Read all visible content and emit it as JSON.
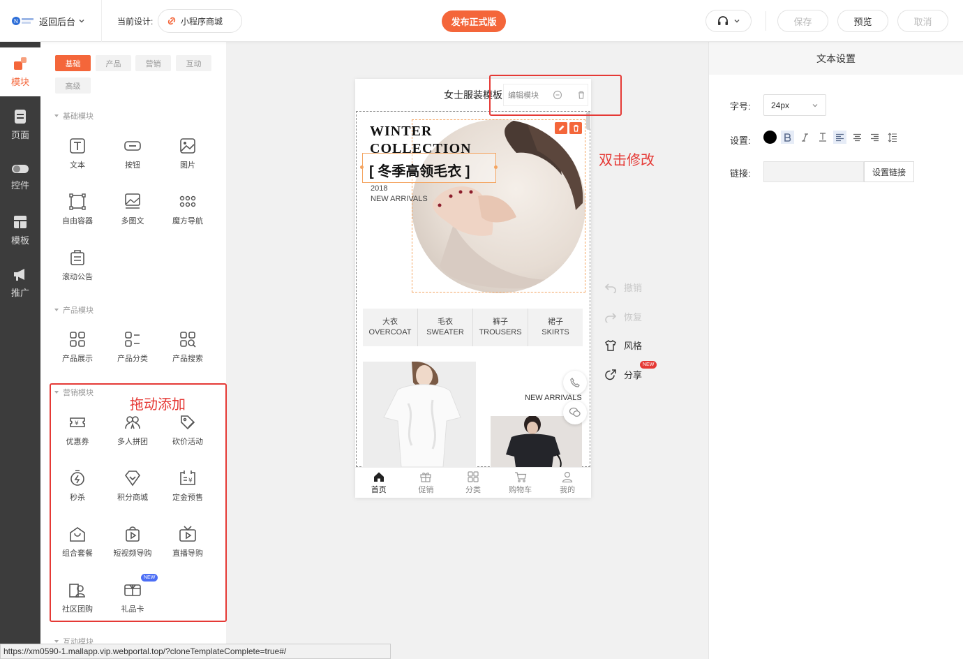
{
  "topbar": {
    "back_label": "返回后台",
    "current_design_label": "当前设计:",
    "design_name": "小程序商城",
    "publish_label": "发布正式版",
    "save_label": "保存",
    "preview_label": "预览",
    "cancel_label": "取消"
  },
  "leftnav": {
    "items": [
      {
        "label": "模块",
        "icon": "blocks-icon"
      },
      {
        "label": "页面",
        "icon": "page-icon"
      },
      {
        "label": "控件",
        "icon": "toggle-icon"
      },
      {
        "label": "模板",
        "icon": "template-icon"
      },
      {
        "label": "推广",
        "icon": "megaphone-icon"
      }
    ]
  },
  "modpanel": {
    "tabs": [
      "基础",
      "产品",
      "营销",
      "互动",
      "高级"
    ],
    "sections": {
      "basic": {
        "title": "基础模块",
        "items": [
          "文本",
          "按钮",
          "图片",
          "自由容器",
          "多图文",
          "魔方导航",
          "滚动公告"
        ]
      },
      "product": {
        "title": "产品模块",
        "items": [
          "产品展示",
          "产品分类",
          "产品搜索"
        ]
      },
      "marketing": {
        "title": "营销模块",
        "items": [
          "优惠券",
          "多人拼团",
          "砍价活动",
          "秒杀",
          "积分商城",
          "定金预售",
          "组合套餐",
          "短视频导购",
          "直播导购",
          "社区团购",
          "礼品卡"
        ]
      },
      "interactive": {
        "title": "互动模块"
      }
    },
    "new_badge": "NEW",
    "drag_hint": "拖动添加"
  },
  "phone": {
    "title": "女士服装模板",
    "edit_label": "编辑模块",
    "hero": {
      "line1": "WINTER",
      "line2": "COLLECTION",
      "headline": "[ 冬季高领毛衣 ]",
      "year": "2018",
      "sub": "NEW ARRIVALS"
    },
    "categories": [
      {
        "cn": "大衣",
        "en": "OVERCOAT"
      },
      {
        "cn": "毛衣",
        "en": "SWEATER"
      },
      {
        "cn": "裤子",
        "en": "TROUSERS"
      },
      {
        "cn": "裙子",
        "en": "SKIRTS"
      }
    ],
    "promo_sub": "NEW ARRIVALS",
    "tabbar": [
      "首页",
      "促销",
      "分类",
      "购物车",
      "我的"
    ]
  },
  "canvas": {
    "dblclick_hint": "双击修改",
    "tools": {
      "undo": "撤销",
      "redo": "恢复",
      "style": "风格",
      "share": "分享",
      "share_badge": "NEW"
    }
  },
  "rightpanel": {
    "title": "文本设置",
    "font_size_label": "字号:",
    "font_size_value": "24px",
    "settings_label": "设置:",
    "link_label": "链接:",
    "link_value": "",
    "set_link_button": "设置链接"
  },
  "statusbar": {
    "url": "https://xm0590-1.mallapp.vip.webportal.top/?cloneTemplateComplete=true#/"
  },
  "colors": {
    "accent": "#f4663a",
    "annotation": "#e53935",
    "nav_bg": "#3c3c3c"
  }
}
